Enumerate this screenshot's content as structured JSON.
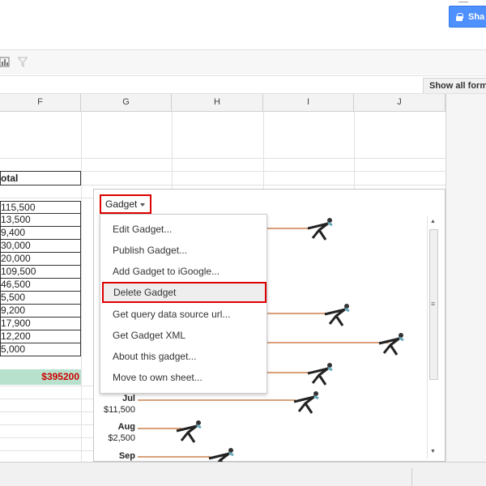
{
  "header": {
    "share_label": "Sha"
  },
  "formula_bar": {
    "show_forms_label": "Show all form"
  },
  "columns": [
    "F",
    "G",
    "H",
    "I",
    "J"
  ],
  "sheet": {
    "total_header": "otal",
    "values": [
      "115,500",
      "13,500",
      "9,400",
      "30,000",
      "20,000",
      "109,500",
      "46,500",
      "5,500",
      "9,200",
      "17,900",
      "12,200",
      "5,000"
    ],
    "sum": "$395200"
  },
  "gadget": {
    "button_label": "Gadget",
    "menu": [
      "Edit Gadget...",
      "Publish Gadget...",
      "Add Gadget to iGoogle...",
      "Delete Gadget",
      "Get query data source url...",
      "Get Gadget XML",
      "About this gadget...",
      "Move to own sheet..."
    ],
    "active_menu_index": 3
  },
  "chart_data": {
    "type": "bar",
    "categories": [
      "Jul",
      "Aug",
      "Sep"
    ],
    "series": [
      {
        "values": [
          11500,
          2500,
          null
        ]
      }
    ],
    "value_labels": [
      "$11,500",
      "$2,500",
      ""
    ]
  },
  "colors": {
    "accent_red": "#dd0000",
    "share_blue": "#4d90fe",
    "sum_green": "#b7e1cd",
    "bar_line": "#d9a07a"
  },
  "icons": [
    "lock-icon",
    "chart-icon",
    "filter-icon",
    "caret-down-icon",
    "puller-figure-icon"
  ]
}
